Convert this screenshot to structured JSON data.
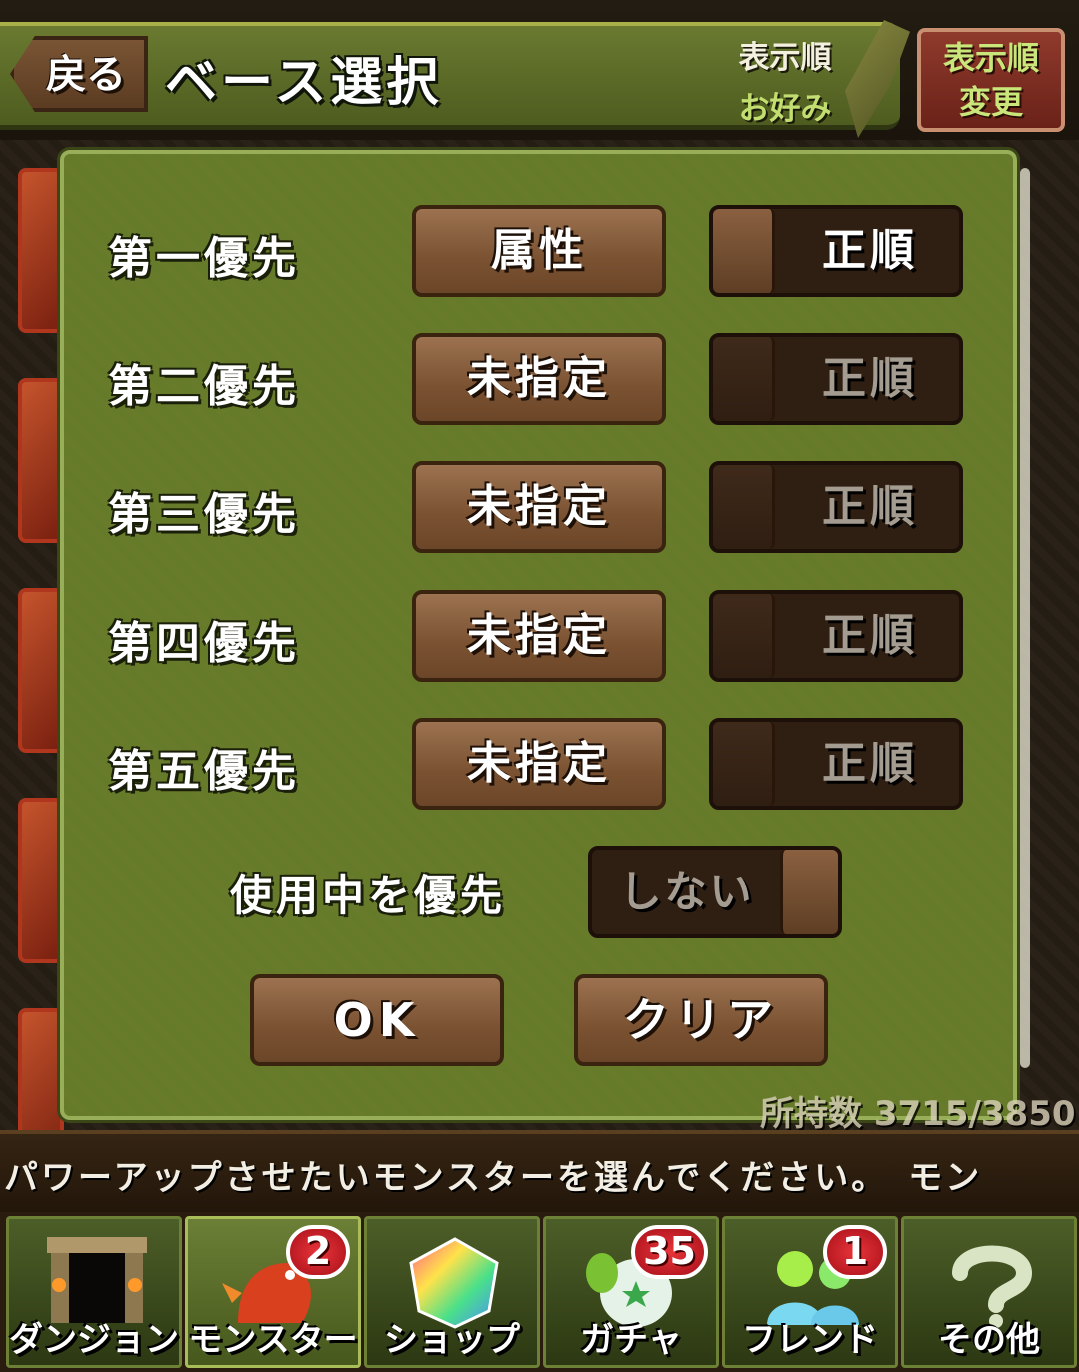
{
  "header": {
    "back_label": "戻る",
    "title": "ベース選択",
    "sort_label": "表示順",
    "sort_value": "お好み",
    "sort_change_line1": "表示順",
    "sort_change_line2": "変更"
  },
  "dialog": {
    "rows": [
      {
        "label": "第一優先",
        "attribute": "属性",
        "order": "正順",
        "active": true
      },
      {
        "label": "第二優先",
        "attribute": "未指定",
        "order": "正順",
        "active": false
      },
      {
        "label": "第三優先",
        "attribute": "未指定",
        "order": "正順",
        "active": false
      },
      {
        "label": "第四優先",
        "attribute": "未指定",
        "order": "正順",
        "active": false
      },
      {
        "label": "第五優先",
        "attribute": "未指定",
        "order": "正順",
        "active": false
      }
    ],
    "use_priority_label": "使用中を優先",
    "use_priority_value": "しない",
    "ok_label": "OK",
    "clear_label": "クリア"
  },
  "box_count": "所持数 3715/3850",
  "message": "パワーアップさせたいモンスターを選んでください。　モン",
  "nav": {
    "items": [
      {
        "label": "ダンジョン",
        "icon": "dungeon-gate-icon",
        "badge": ""
      },
      {
        "label": "モンスター",
        "icon": "dragon-icon",
        "badge": "2"
      },
      {
        "label": "ショップ",
        "icon": "rainbow-gem-icon",
        "badge": ""
      },
      {
        "label": "ガチャ",
        "icon": "egg-icon",
        "badge": "35"
      },
      {
        "label": "フレンド",
        "icon": "friends-icon",
        "badge": "1"
      },
      {
        "label": "その他",
        "icon": "question-icon",
        "badge": ""
      }
    ]
  },
  "colors": {
    "dialog_bg": "#6c822c",
    "button_brown": "#7a5232",
    "badge_red": "#d0202a",
    "header_green": "#5e6e28"
  }
}
